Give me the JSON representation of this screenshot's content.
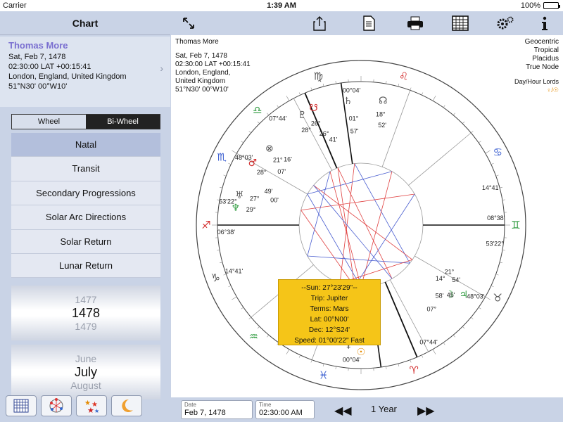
{
  "status": {
    "carrier": "Carrier",
    "time": "1:39 AM",
    "battery": "100%",
    "battery_level": 1.0
  },
  "sidebar": {
    "title": "Chart",
    "profile": {
      "name": "Thomas More",
      "date": "Sat, Feb 7, 1478",
      "time": "02:30:00 LAT +00:15:41",
      "place": "London, England, United Kingdom",
      "coords": "51°N30' 00°W10'"
    },
    "segments": {
      "wheel": "Wheel",
      "biwheel": "Bi-Wheel",
      "selected": "Bi-Wheel"
    },
    "menu": [
      {
        "label": "Natal",
        "active": true
      },
      {
        "label": "Transit",
        "active": false
      },
      {
        "label": "Secondary Progressions",
        "active": false
      },
      {
        "label": "Solar Arc Directions",
        "active": false
      },
      {
        "label": "Solar Return",
        "active": false
      },
      {
        "label": "Lunar Return",
        "active": false
      }
    ],
    "year_picker": {
      "prev": "1477",
      "selected": "1478",
      "next": "1479"
    },
    "month_picker": {
      "prev": "June",
      "selected": "July",
      "next": "August"
    },
    "tools": [
      "grid-icon",
      "aspect-pattern-icon",
      "stars-icon",
      "moon-icon"
    ]
  },
  "toolbar": {
    "icons": [
      "expand-icon",
      "share-icon",
      "document-icon",
      "print-icon",
      "table-icon",
      "settings-icon",
      "info-icon"
    ]
  },
  "chart": {
    "name": "Thomas More",
    "date": "Sat, Feb 7, 1478",
    "time": "02:30:00 LAT +00:15:41",
    "place1": "London, England,",
    "place2": "United Kingdom",
    "coords": "51°N30' 00°W10'",
    "settings": [
      "Geocentric",
      "Tropical",
      "Placidus",
      "True Node"
    ],
    "lords_label": "Day/Hour Lords",
    "lords_glyphs": "♀/☉",
    "cusp_labels": [
      {
        "text": "00°04'"
      },
      {
        "text": "07°44'"
      },
      {
        "text": "48°03'"
      },
      {
        "text": "53'22°"
      },
      {
        "text": "06°38'"
      },
      {
        "text": "14°41'"
      },
      {
        "text": "00°04'"
      },
      {
        "text": "07°44'"
      },
      {
        "text": "48°03'"
      },
      {
        "text": "53'22°"
      },
      {
        "text": "08°38'"
      },
      {
        "text": "14°41'"
      }
    ],
    "planet_labels": [
      "28°",
      "26°",
      "26°",
      "41'",
      "01°",
      "57'",
      "18°",
      "52'",
      "21°",
      "28°",
      "16'",
      "07'",
      "27°",
      "49'",
      "29°",
      "00'",
      "54'",
      "45'",
      "58'",
      "21°",
      "14°",
      "07°"
    ],
    "tooltip": {
      "line1": "--Sun: 27°23'29\"--",
      "line2": "Trip: Jupiter",
      "line3": "Terms: Mars",
      "line4": "Lat: 00°N00'",
      "line5": "Dec: 12°S24'",
      "line6": "Speed: 01°00'22\" Fast"
    },
    "colors": {
      "fire": "#d32f2f",
      "earth": "#555555",
      "air": "#2e9a3e",
      "water": "#3b5fd0",
      "aspect_red": "#e04040",
      "aspect_blue": "#4a5ed0",
      "tooltip": "#f5c518"
    }
  },
  "bottom": {
    "date_label": "Date",
    "date_value": "Feb 7, 1478",
    "time_label": "Time",
    "time_value": "02:30:00 AM",
    "prev_button": "◀◀",
    "next_button": "▶▶",
    "interval": "1 Year"
  }
}
